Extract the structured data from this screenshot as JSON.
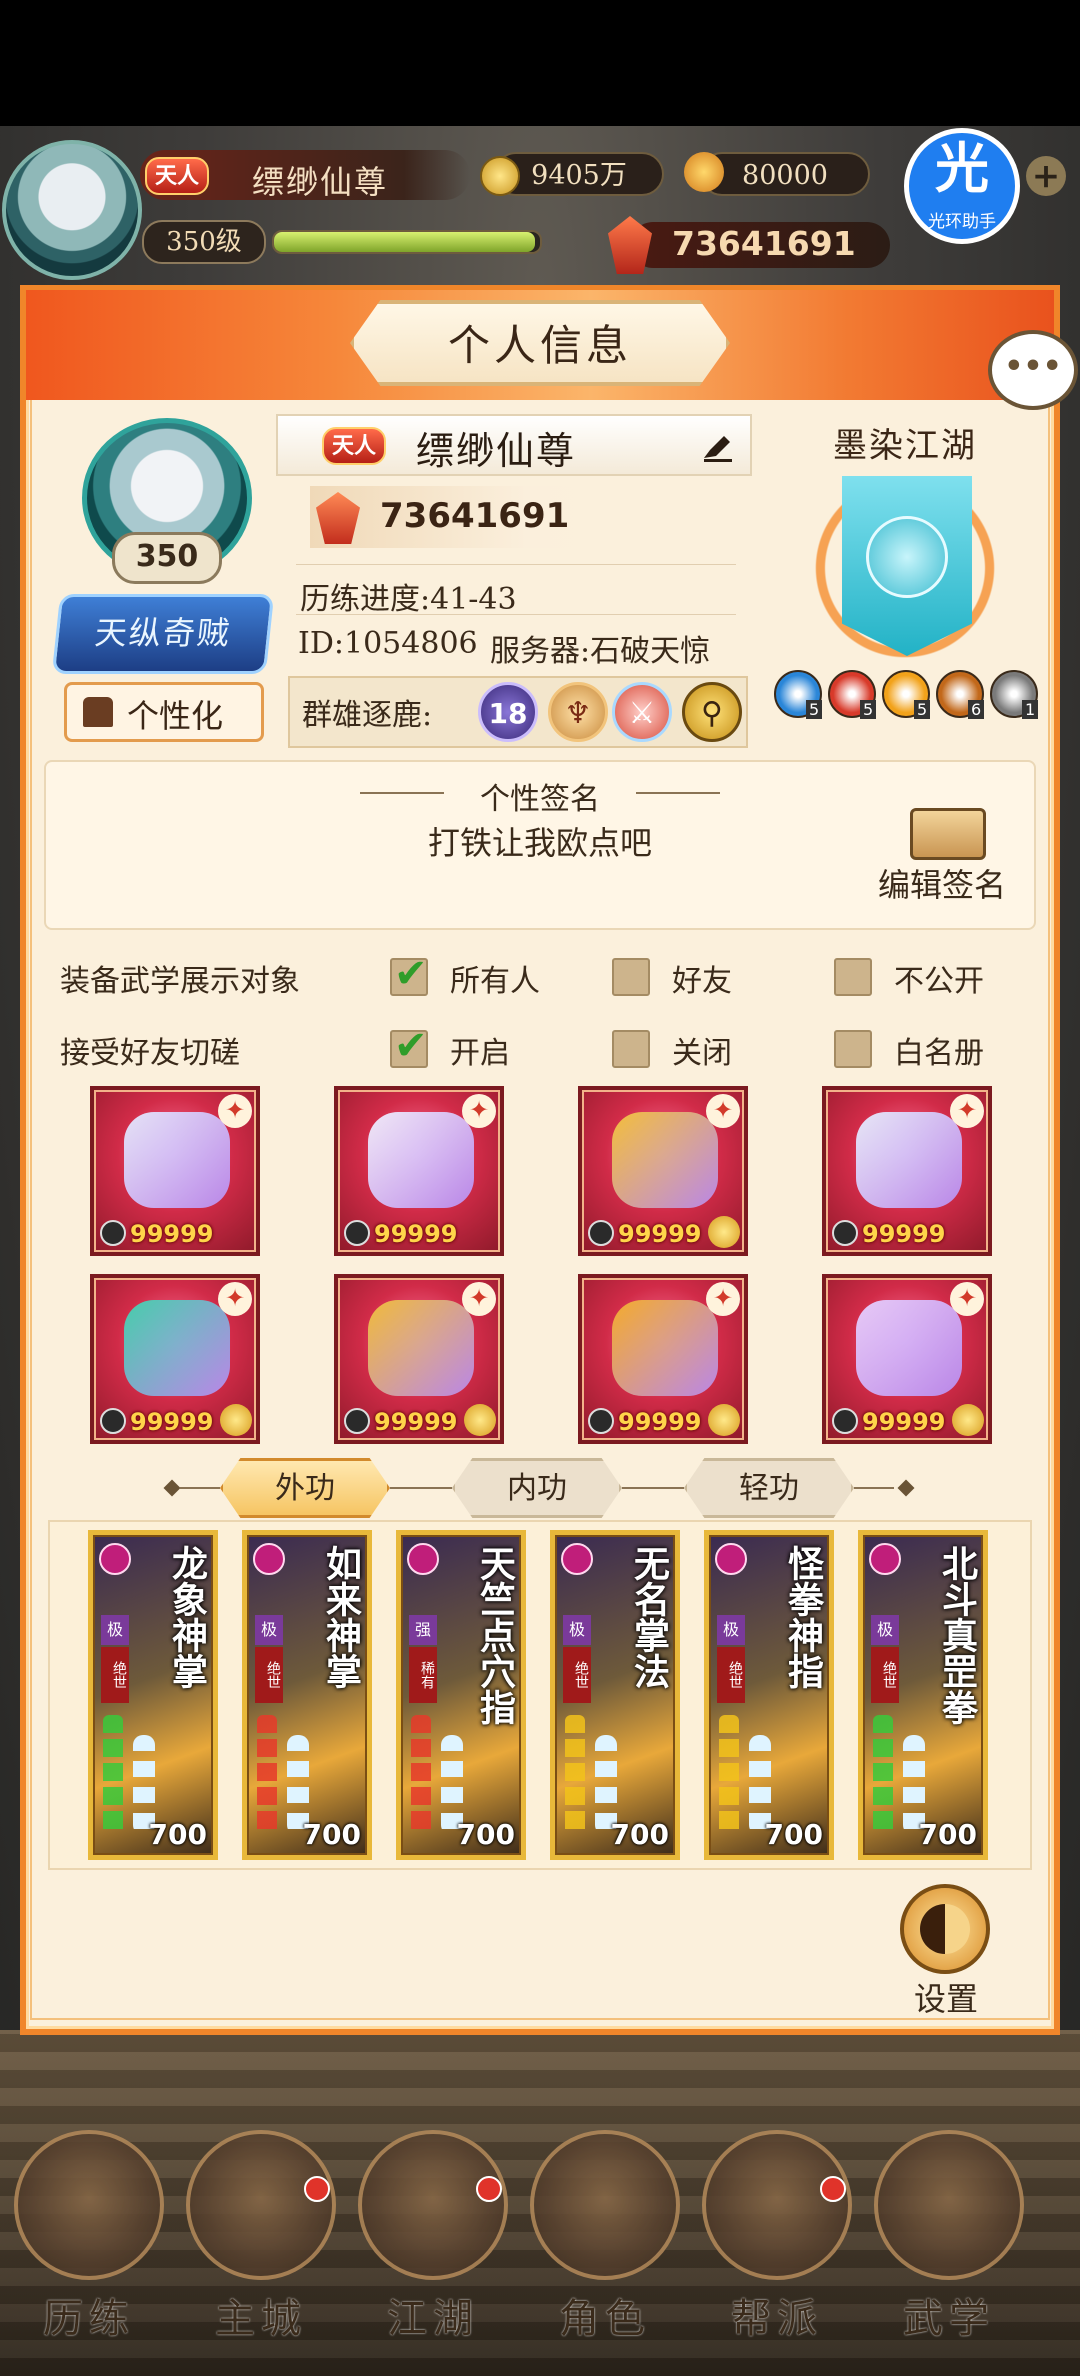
{
  "hud": {
    "rank_badge": "天人",
    "player_name": "缥缈仙尊",
    "level": "350级",
    "exp_progress": 0.98,
    "coins": "9405万",
    "ingots": "80000",
    "power": "73641691",
    "assist_char": "光",
    "assist_label": "光环助手"
  },
  "panel": {
    "title": "个人信息",
    "chat_icon": "chat-bubble-icon"
  },
  "profile": {
    "avatar_level": "350",
    "title_badge": "天纵奇贼",
    "personalize_label": "个性化",
    "rank_badge": "天人",
    "name": "缥缈仙尊",
    "power": "73641691",
    "progress": "历练进度:41-43",
    "id": "ID:1054806",
    "server": "服务器:石破天惊",
    "arena_label": "群雄逐鹿:",
    "arena_rank": "18"
  },
  "sect": {
    "name": "墨染江湖",
    "icons": [
      {
        "name": "water",
        "count": "5",
        "color": "#2a86d8"
      },
      {
        "name": "fire",
        "count": "5",
        "color": "#d83a2a"
      },
      {
        "name": "sun",
        "count": "5",
        "color": "#f2a21a"
      },
      {
        "name": "beast",
        "count": "6",
        "color": "#c2681a"
      },
      {
        "name": "helmet",
        "count": "1",
        "color": "#7a7a7a"
      }
    ]
  },
  "signature": {
    "title": "个性签名",
    "text": "打铁让我欧点吧",
    "edit_label": "编辑签名"
  },
  "settings": {
    "rows": [
      {
        "label": "装备武学展示对象",
        "options": [
          {
            "label": "所有人",
            "checked": true
          },
          {
            "label": "好友",
            "checked": false
          },
          {
            "label": "不公开",
            "checked": false
          }
        ]
      },
      {
        "label": "接受好友切磋",
        "options": [
          {
            "label": "开启",
            "checked": true
          },
          {
            "label": "关闭",
            "checked": false
          },
          {
            "label": "白名册",
            "checked": false
          }
        ]
      }
    ]
  },
  "equipment": [
    {
      "name": "gauntlet",
      "qty": "99999",
      "linked": false
    },
    {
      "name": "robe",
      "qty": "99999",
      "linked": false
    },
    {
      "name": "belt",
      "qty": "99999",
      "linked": true
    },
    {
      "name": "boots",
      "qty": "99999",
      "linked": false
    },
    {
      "name": "necklace",
      "qty": "99999",
      "linked": true
    },
    {
      "name": "hairpin",
      "qty": "99999",
      "linked": true
    },
    {
      "name": "ring",
      "qty": "99999",
      "linked": true
    },
    {
      "name": "bracelet",
      "qty": "99999",
      "linked": true
    }
  ],
  "tabs": [
    "外功",
    "内功",
    "轻功"
  ],
  "skills": [
    {
      "name": "龙象神掌",
      "tier": "极",
      "rank": "绝世",
      "gem": "green",
      "power": "700"
    },
    {
      "name": "如来神掌",
      "tier": "极",
      "rank": "绝世",
      "gem": "red",
      "power": "700"
    },
    {
      "name": "天竺点穴指",
      "tier": "强",
      "rank": "稀有",
      "gem": "red",
      "power": "700"
    },
    {
      "name": "无名掌法",
      "tier": "极",
      "rank": "绝世",
      "gem": "yellow",
      "power": "700"
    },
    {
      "name": "怪拳神指",
      "tier": "极",
      "rank": "绝世",
      "gem": "yellow",
      "power": "700"
    },
    {
      "name": "北斗真罡拳",
      "tier": "极",
      "rank": "绝世",
      "gem": "green",
      "power": "700"
    }
  ],
  "settings_btn": "设置",
  "nav": [
    {
      "label": "历练",
      "dot": false
    },
    {
      "label": "主城",
      "dot": true
    },
    {
      "label": "江湖",
      "dot": true
    },
    {
      "label": "角色",
      "dot": false
    },
    {
      "label": "帮派",
      "dot": true
    },
    {
      "label": "武学",
      "dot": false
    }
  ]
}
